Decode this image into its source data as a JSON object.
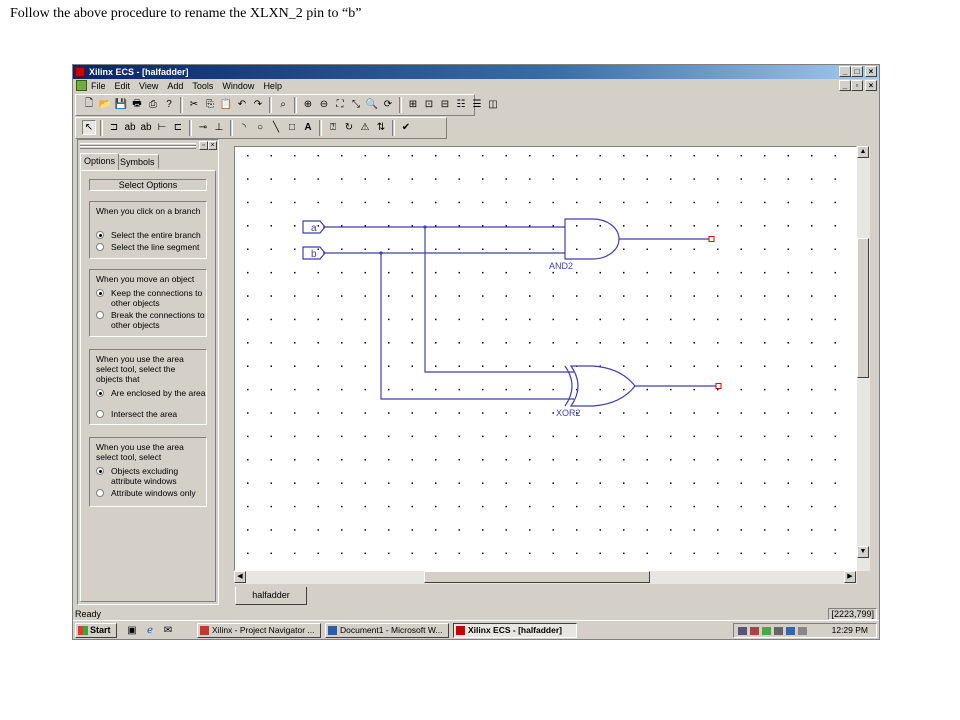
{
  "caption": "Follow the above procedure to rename the XLXN_2 pin to “b”",
  "window": {
    "title": "Xilinx ECS - [halfadder]",
    "min": "_",
    "max": "□",
    "close": "×"
  },
  "menu": [
    "File",
    "Edit",
    "View",
    "Add",
    "Tools",
    "Window",
    "Help"
  ],
  "left_panel": {
    "tabs": [
      "Options",
      "Symbols"
    ],
    "select_options": "Select Options",
    "groups": [
      {
        "title": "When you click on a branch",
        "options": [
          "Select the entire branch",
          "Select the line segment"
        ],
        "selected": 0
      },
      {
        "title": "When you move an object",
        "options": [
          "Keep the connections to other objects",
          "Break the connections to other objects"
        ],
        "selected": 0
      },
      {
        "title": "When you use the area select tool, select the objects that",
        "options": [
          "Are enclosed by the area",
          "Intersect the area"
        ],
        "selected": 0
      },
      {
        "title": "When you use the area select tool, select",
        "options": [
          "Objects excluding attribute windows",
          "Attribute windows only"
        ],
        "selected": 0
      }
    ]
  },
  "schematic": {
    "pins": [
      "a",
      "b"
    ],
    "gates": [
      "AND2",
      "XOR2"
    ],
    "wire_color": "#3f3fae",
    "marker_color": "#e00000"
  },
  "doc_tab": "halfadder",
  "status": {
    "text": "Ready",
    "coords": "[2223,799]"
  },
  "taskbar": {
    "start": "Start",
    "buttons": [
      "Xilinx - Project Navigator ...",
      "Document1 - Microsoft W...",
      "Xilinx ECS - [halfadder]"
    ],
    "clock": "12:29 PM"
  }
}
